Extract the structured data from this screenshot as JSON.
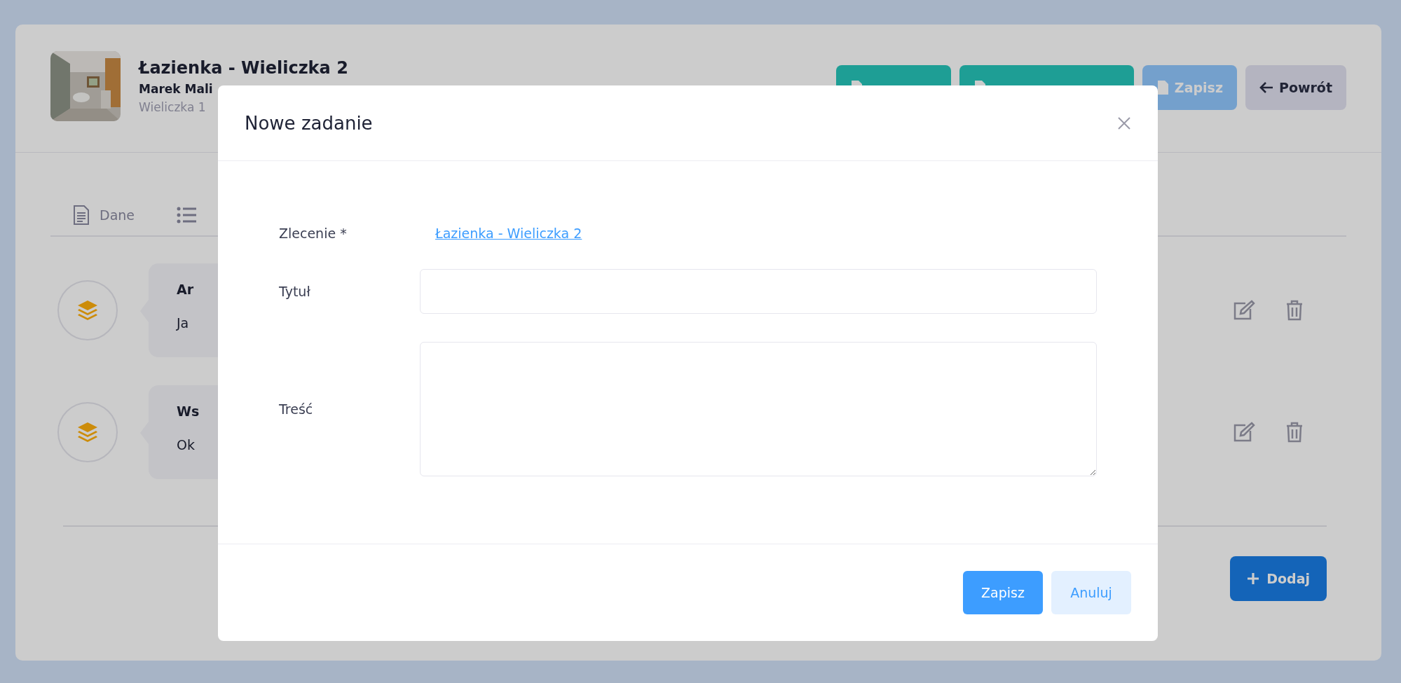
{
  "header": {
    "title": "Łazienka - Wieliczka 2",
    "client": "Marek Mali",
    "address": "Wieliczka 1"
  },
  "actions": [
    {
      "kind": "document"
    },
    {
      "kind": "document"
    },
    {
      "label": "Zapisz",
      "kind": "save"
    },
    {
      "label": "Powrót",
      "kind": "back"
    }
  ],
  "tabs": [
    {
      "label": "Dane",
      "kind": "document"
    },
    {
      "kind": "list"
    }
  ],
  "tasks": [
    {
      "title": "Ar",
      "text": "Ja"
    },
    {
      "title": "Ws",
      "text": "Ok"
    }
  ],
  "add_button": "Dodaj",
  "modal": {
    "title": "Nowe zadanie",
    "fields": [
      {
        "kind": "link",
        "label": "Zlecenie *",
        "value": "Łazienka - Wieliczka 2"
      },
      {
        "kind": "input",
        "label": "Tytuł"
      },
      {
        "kind": "textarea",
        "label": "Treść"
      }
    ],
    "buttons": [
      {
        "label": "Zapisz",
        "kind": "primary"
      },
      {
        "label": "Anuluj",
        "kind": "secondary"
      }
    ]
  }
}
